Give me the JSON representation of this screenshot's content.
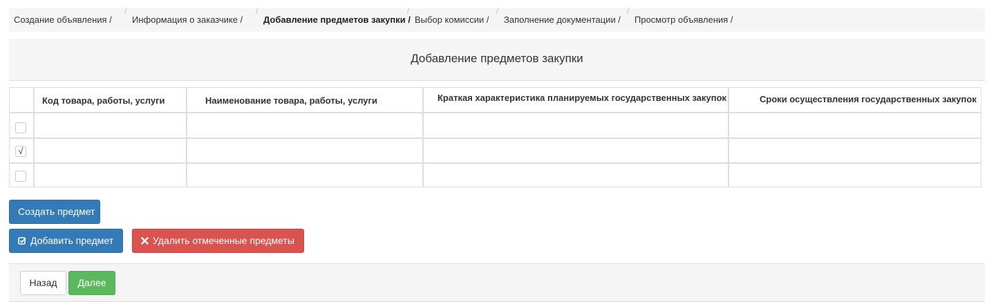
{
  "breadcrumb": {
    "items": [
      "Создание объявления /",
      "Информация о заказчике  /",
      "Добавление предметов закупки /",
      "Выбор комиссии /",
      "Заполнение документации /",
      "Просмотр объявления /"
    ],
    "separator": "/"
  },
  "panel": {
    "title": "Добавление предметов закупки"
  },
  "table": {
    "headers": [
      "Код товара, работы, услуги",
      "Наименование товара, работы, услуги",
      "Краткая характеристика планируемых государственных закупок",
      "Сроки осуществления государственных закупок"
    ],
    "rows": [
      {
        "checked": false,
        "cells": [
          "",
          "",
          "",
          ""
        ]
      },
      {
        "checked": true,
        "cells": [
          "",
          "",
          "",
          ""
        ]
      },
      {
        "checked": false,
        "cells": [
          "",
          "",
          "",
          ""
        ]
      }
    ],
    "check_glyph": "√"
  },
  "buttons": {
    "create": "Создать предмет",
    "add": "Добавить предмет",
    "add_icon": "checkbox-edit-icon",
    "delete": "Удалить отмеченные предметы",
    "delete_icon": "close-icon",
    "back": "Назад",
    "next": "Далее"
  },
  "colors": {
    "primary": "#337ab7",
    "danger": "#d9534f",
    "success": "#5cb85c"
  }
}
